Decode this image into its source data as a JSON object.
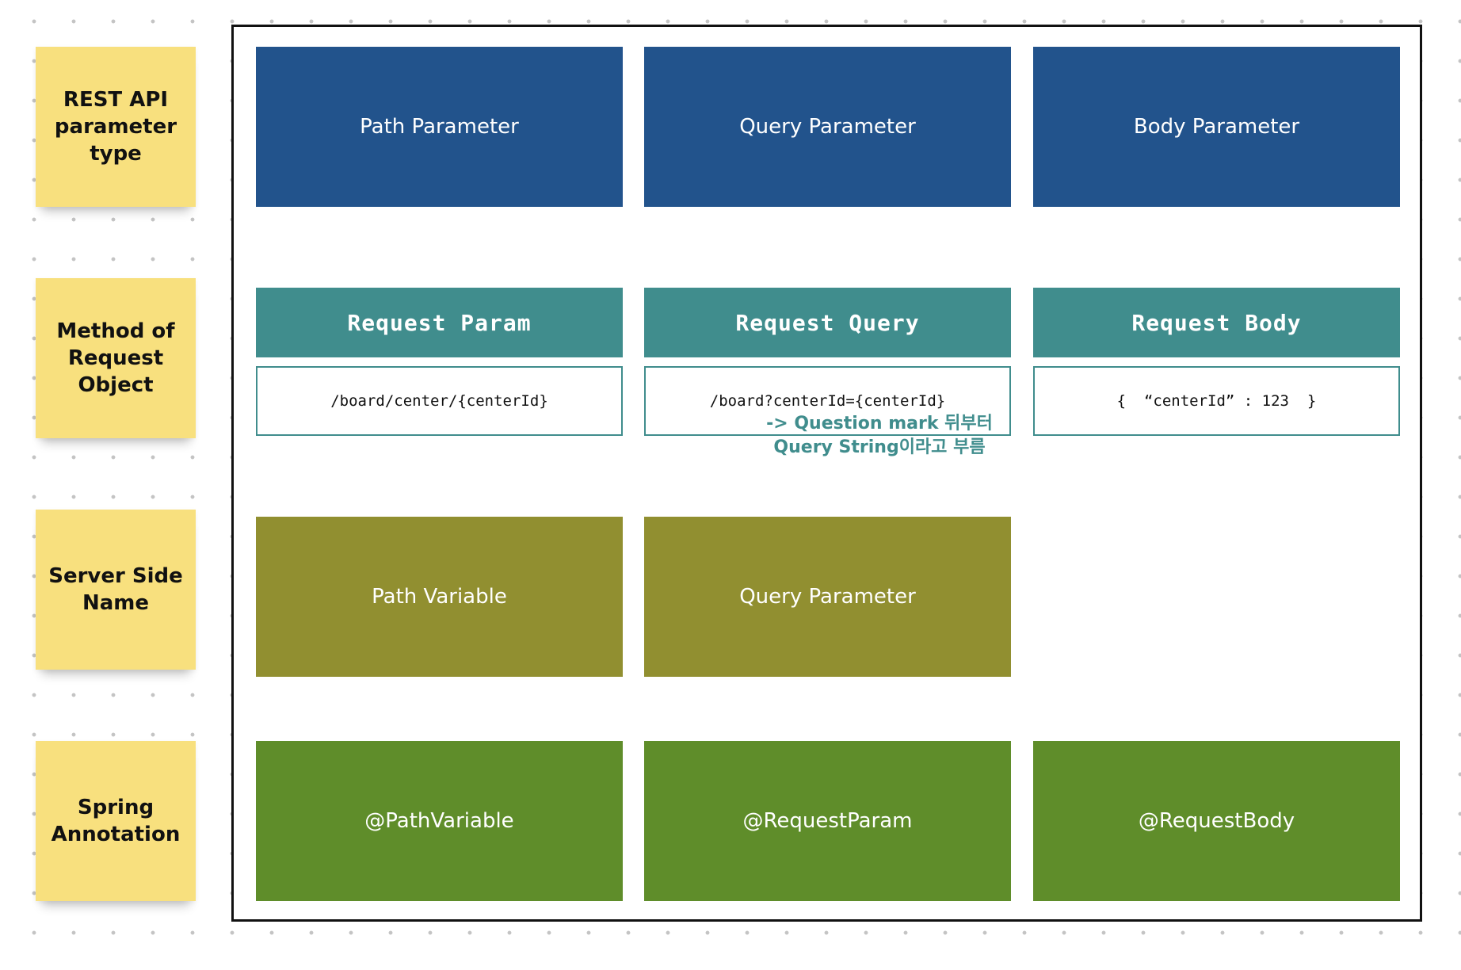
{
  "row_labels": [
    "REST API parameter type",
    "Method of Request Object",
    "Server Side Name",
    "Spring Annotation"
  ],
  "parameter_types": [
    "Path Parameter",
    "Query Parameter",
    "Body Parameter"
  ],
  "request_methods": {
    "headers": [
      "Request Param",
      "Request Query",
      "Request Body"
    ],
    "examples": [
      "/board/center/{centerId}",
      "/board?centerId={centerId}",
      "{  “centerId” : 123  }"
    ],
    "annotation": {
      "line1": "-> Question mark 뒤부터",
      "line2": "Query String이라고 부름"
    }
  },
  "server_side_names": [
    "Path Variable",
    "Query Parameter"
  ],
  "spring_annotations": [
    "@PathVariable",
    "@RequestParam",
    "@RequestBody"
  ],
  "colors": {
    "sticky": "#f8e07e",
    "parameter_type": "#22538c",
    "request_method": "#408d8d",
    "server_side_name": "#918f30",
    "spring_annotation": "#5f8d2a",
    "frame_border": "#111111"
  }
}
